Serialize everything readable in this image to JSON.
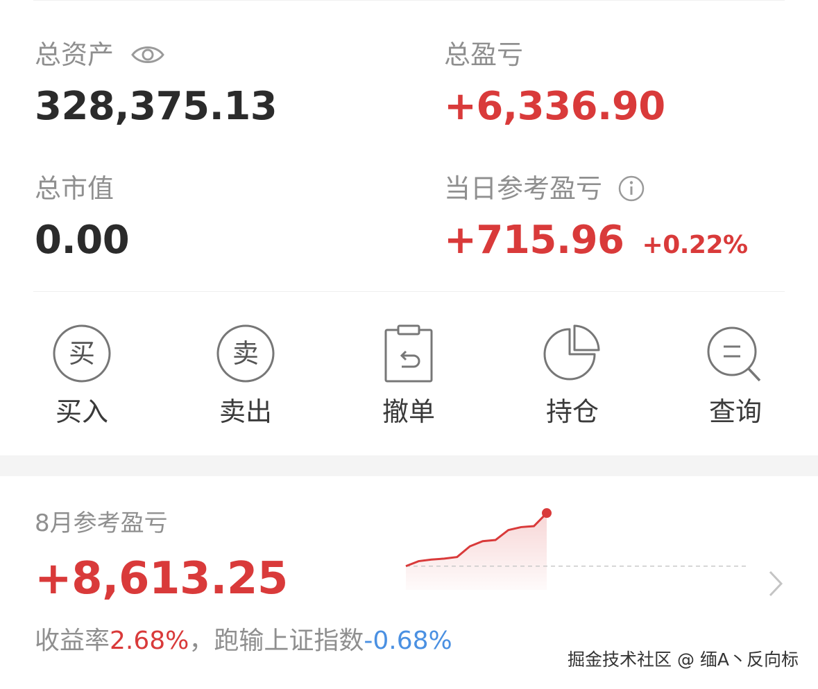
{
  "summary": {
    "total_assets_label": "总资产",
    "total_assets_value": "328,375.13",
    "total_pnl_label": "总盈亏",
    "total_pnl_value": "+6,336.90",
    "market_value_label": "总市值",
    "market_value_value": "0.00",
    "daily_pnl_label": "当日参考盈亏",
    "daily_pnl_value": "+715.96",
    "daily_pnl_pct": "+0.22%"
  },
  "actions": [
    {
      "icon_char": "买",
      "label": "买入",
      "icon": "buy-icon"
    },
    {
      "icon_char": "卖",
      "label": "卖出",
      "icon": "sell-icon"
    },
    {
      "label": "撤单",
      "icon": "cancel-order-icon"
    },
    {
      "label": "持仓",
      "icon": "pie-chart-icon"
    },
    {
      "label": "查询",
      "icon": "search-icon"
    }
  ],
  "monthly": {
    "title": "8月参考盈亏",
    "value": "+8,613.25",
    "return_label": "收益率",
    "return_value": "2.68%",
    "beat_label": "，跑输上证指数",
    "beat_value": "-0.68%",
    "sparkline_label": "2.68%"
  },
  "chart_data": {
    "type": "area",
    "series": [
      {
        "values": [
          0.0,
          0.25,
          0.33,
          0.38,
          0.46,
          1.0,
          1.26,
          1.32,
          1.82,
          1.97,
          2.02,
          2.68
        ]
      }
    ],
    "annotations": [
      "2.68%"
    ],
    "ylim": [
      -1.2,
      3.0
    ],
    "baseline": 0,
    "colors": {
      "line": "#d93a3a",
      "fill": "#f7d6d6",
      "baseline": "#c8c8c8"
    }
  },
  "watermark": "掘金技术社区 @ 缅A丶反向标",
  "colors": {
    "red": "#d93a3a",
    "blue": "#4a90e2",
    "gray": "#8f8f8f",
    "dark": "#2b2b2b"
  }
}
